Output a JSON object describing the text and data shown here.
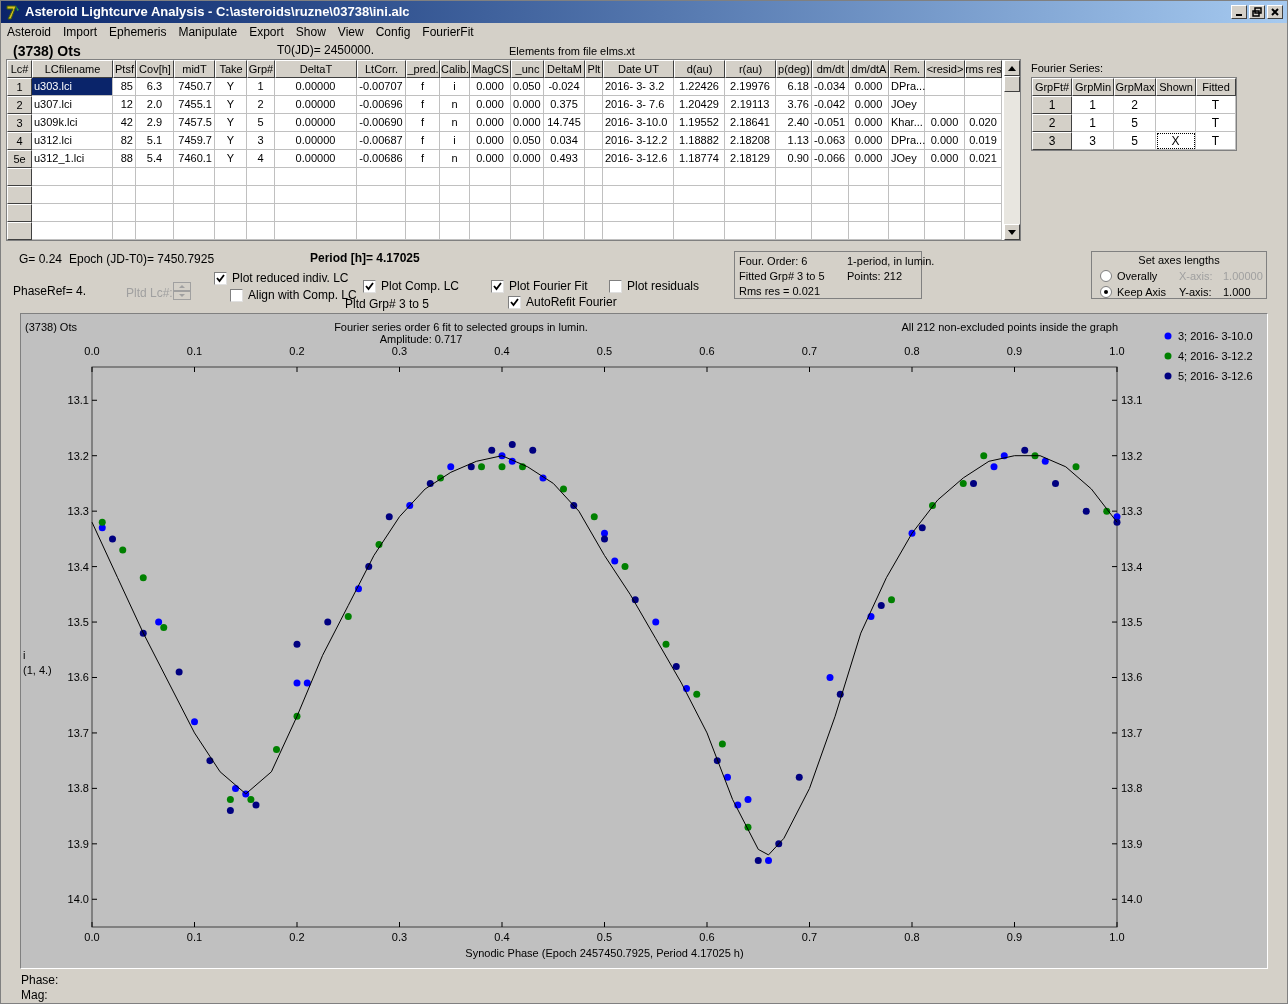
{
  "window": {
    "title": "Asteroid Lightcurve Analysis - C:\\asteroids\\ruzne\\03738\\ini.alc"
  },
  "menu": [
    "Asteroid",
    "Import",
    "Ephemeris",
    "Manipulate",
    "Export",
    "Show",
    "View",
    "Config",
    "FourierFit"
  ],
  "header": {
    "object": "(3738) Ots",
    "t0": "T0(JD)= 2450000.",
    "elements": "Elements from file elms.xt"
  },
  "lc_table": {
    "columns": [
      "Lc#",
      "LCfilename",
      "Ptsf",
      "Cov[h]",
      "midT",
      "Take",
      "Grp#",
      "DeltaT",
      "LtCorr.",
      "_pred.",
      "Calib.",
      "MagCS",
      "_unc",
      "DeltaM",
      "Plt",
      "Date UT",
      "d(au)",
      "r(au)",
      "p(deg)",
      "dm/dt",
      "dm/dtA",
      "Rem.",
      "<resid>",
      "rms res"
    ],
    "rows": [
      {
        "selected": true,
        "cells": [
          "1",
          "u303.lci",
          "85",
          "6.3",
          "7450.7",
          "Y",
          "1",
          "0.00000",
          "-0.00707",
          "f",
          "i",
          "0.000",
          "0.050",
          "-0.024",
          "",
          "2016- 3- 3.2",
          "1.22426",
          "2.19976",
          "6.18",
          "-0.034",
          "0.000",
          "DPra...",
          "",
          ""
        ]
      },
      {
        "selected": false,
        "cells": [
          "2",
          "u307.lci",
          "12",
          "2.0",
          "7455.1",
          "Y",
          "2",
          "0.00000",
          "-0.00696",
          "f",
          "n",
          "0.000",
          "0.000",
          "0.375",
          "",
          "2016- 3- 7.6",
          "1.20429",
          "2.19113",
          "3.76",
          "-0.042",
          "0.000",
          "JOey",
          "",
          ""
        ]
      },
      {
        "selected": false,
        "cells": [
          "3",
          "u309k.lci",
          "42",
          "2.9",
          "7457.5",
          "Y",
          "5",
          "0.00000",
          "-0.00690",
          "f",
          "n",
          "0.000",
          "0.000",
          "14.745",
          "",
          "2016- 3-10.0",
          "1.19552",
          "2.18641",
          "2.40",
          "-0.051",
          "0.000",
          "Khar...",
          "0.000",
          "0.020"
        ]
      },
      {
        "selected": false,
        "cells": [
          "4",
          "u312.lci",
          "82",
          "5.1",
          "7459.7",
          "Y",
          "3",
          "0.00000",
          "-0.00687",
          "f",
          "i",
          "0.000",
          "0.050",
          "0.034",
          "",
          "2016- 3-12.2",
          "1.18882",
          "2.18208",
          "1.13",
          "-0.063",
          "0.000",
          "DPra...",
          "0.000",
          "0.019"
        ]
      },
      {
        "selected": false,
        "cells": [
          "5e",
          "u312_1.lci",
          "88",
          "5.4",
          "7460.1",
          "Y",
          "4",
          "0.00000",
          "-0.00686",
          "f",
          "n",
          "0.000",
          "0.000",
          "0.493",
          "",
          "2016- 3-12.6",
          "1.18774",
          "2.18129",
          "0.90",
          "-0.066",
          "0.000",
          "JOey",
          "0.000",
          "0.021"
        ]
      }
    ]
  },
  "fourier_series": {
    "title": "Fourier Series:",
    "columns": [
      "GrpFt#",
      "GrpMin",
      "GrpMax",
      "Shown",
      "Fitted"
    ],
    "rows": [
      {
        "focused": false,
        "cells": [
          "1",
          "1",
          "2",
          "",
          "T"
        ]
      },
      {
        "focused": false,
        "cells": [
          "2",
          "1",
          "5",
          "",
          "T"
        ]
      },
      {
        "focused": true,
        "cells": [
          "3",
          "3",
          "5",
          "X",
          "T"
        ]
      }
    ]
  },
  "info": {
    "g": "G= 0.24",
    "epoch": "Epoch (JD-T0)= 7450.7925",
    "period": "Period [h]= 4.17025",
    "phase_ref": "PhaseRef= 4.",
    "pltd_lc": {
      "label": "Pltd Lc#:",
      "disabled": true
    },
    "pltd_grp": "Pltd Grp#  3   to   5"
  },
  "plot_options": [
    {
      "label": "Plot reduced indiv. LC",
      "checked": true
    },
    {
      "label": "Align with Comp. LC",
      "checked": false
    },
    {
      "label": "Plot Comp. LC",
      "checked": true
    },
    {
      "label": "Plot Fourier Fit",
      "checked": true
    },
    {
      "label": "AutoRefit Fourier",
      "checked": true
    },
    {
      "label": "Plot residuals",
      "checked": false
    }
  ],
  "fit_summary": [
    "Four. Order:  6",
    "1-period, in lumin.",
    "Fitted Grp# 3 to 5",
    "Points: 212",
    "Rms res     = 0.021"
  ],
  "axes_lengths": {
    "title": "Set axes lengths",
    "options": [
      {
        "label": "Overally",
        "selected": false
      },
      {
        "label": "Keep Axis",
        "selected": true
      }
    ],
    "fields": [
      {
        "label": "X-axis:",
        "value": "1.00000",
        "disabled": true
      },
      {
        "label": "Y-axis:",
        "value": "1.000",
        "disabled": false
      }
    ]
  },
  "plot": {
    "object": "(3738) Ots",
    "subtitle": "Fourier series order 6 fit to selected groups in lumin.",
    "amplitude": "Amplitude: 0.717",
    "points_note": "All 212 non-excluded points inside the graph",
    "y_scale": "(1, 4.)",
    "chart_data": {
      "type": "scatter",
      "xlabel": "Synodic Phase (Epoch 2457450.7925, Period 4.17025 h)",
      "ylabel": "i",
      "xlim": [
        0,
        1
      ],
      "legend": "right",
      "ylim": [
        14.05,
        13.04
      ],
      "xticks": [
        {
          "value": 0,
          "label": "0.0"
        },
        {
          "value": 0.1,
          "label": "0.1"
        },
        {
          "value": 0.2,
          "label": "0.2"
        },
        {
          "value": 0.3,
          "label": "0.3"
        },
        {
          "value": 0.4,
          "label": "0.4"
        },
        {
          "value": 0.5,
          "label": "0.5"
        },
        {
          "value": 0.6,
          "label": "0.6"
        },
        {
          "value": 0.7,
          "label": "0.7"
        },
        {
          "value": 0.8,
          "label": "0.8"
        },
        {
          "value": 0.9,
          "label": "0.9"
        },
        {
          "value": 1,
          "label": "1.0"
        }
      ],
      "yticks": [
        {
          "value": 13.1,
          "label": "13.1"
        },
        {
          "value": 13.2,
          "label": "13.2"
        },
        {
          "value": 13.3,
          "label": "13.3"
        },
        {
          "value": 13.4,
          "label": "13.4"
        },
        {
          "value": 13.5,
          "label": "13.5"
        },
        {
          "value": 13.6,
          "label": "13.6"
        },
        {
          "value": 13.7,
          "label": "13.7"
        },
        {
          "value": 13.8,
          "label": "13.8"
        },
        {
          "value": 13.9,
          "label": "13.9"
        },
        {
          "value": 14.0,
          "label": "14.0"
        }
      ],
      "series": [
        {
          "name": "3; 2016- 3-10.0",
          "color": "#0000ff",
          "x": [
            0.01,
            0.065,
            0.1,
            0.14,
            0.15,
            0.2,
            0.21,
            0.26,
            0.31,
            0.35,
            0.4,
            0.41,
            0.44,
            0.5,
            0.51,
            0.55,
            0.58,
            0.62,
            0.63,
            0.64,
            0.66,
            0.72,
            0.76,
            0.8,
            0.88,
            0.89,
            0.93,
            1.0
          ],
          "values": [
            13.33,
            13.5,
            13.68,
            13.8,
            13.81,
            13.61,
            13.61,
            13.44,
            13.29,
            13.22,
            13.2,
            13.21,
            13.24,
            13.34,
            13.39,
            13.5,
            13.62,
            13.78,
            13.83,
            13.82,
            13.93,
            13.6,
            13.49,
            13.34,
            13.22,
            13.2,
            13.21,
            13.31
          ]
        },
        {
          "name": "4; 2016- 3-12.2",
          "color": "#008000",
          "x": [
            0.01,
            0.03,
            0.05,
            0.07,
            0.135,
            0.155,
            0.18,
            0.2,
            0.25,
            0.28,
            0.34,
            0.38,
            0.4,
            0.42,
            0.46,
            0.49,
            0.52,
            0.56,
            0.59,
            0.615,
            0.64,
            0.78,
            0.82,
            0.85,
            0.87,
            0.92,
            0.96,
            0.99
          ],
          "values": [
            13.32,
            13.37,
            13.42,
            13.51,
            13.82,
            13.82,
            13.73,
            13.67,
            13.49,
            13.36,
            13.24,
            13.22,
            13.22,
            13.22,
            13.26,
            13.31,
            13.4,
            13.54,
            13.63,
            13.72,
            13.87,
            13.46,
            13.29,
            13.25,
            13.2,
            13.2,
            13.22,
            13.3
          ]
        },
        {
          "name": "5; 2016- 3-12.6",
          "color": "#000080",
          "x": [
            0.02,
            0.05,
            0.085,
            0.115,
            0.135,
            0.16,
            0.2,
            0.23,
            0.27,
            0.29,
            0.33,
            0.37,
            0.39,
            0.41,
            0.43,
            0.47,
            0.5,
            0.53,
            0.57,
            0.61,
            0.65,
            0.67,
            0.69,
            0.73,
            0.77,
            0.81,
            0.86,
            0.91,
            0.94,
            0.97,
            1.0
          ],
          "values": [
            13.35,
            13.52,
            13.59,
            13.75,
            13.84,
            13.83,
            13.54,
            13.5,
            13.4,
            13.31,
            13.25,
            13.22,
            13.19,
            13.18,
            13.19,
            13.29,
            13.35,
            13.46,
            13.58,
            13.75,
            13.93,
            13.9,
            13.78,
            13.63,
            13.47,
            13.33,
            13.25,
            13.19,
            13.25,
            13.3,
            13.32
          ]
        },
        {
          "type": "line",
          "color": "#000000",
          "x": [
            0,
            0.025,
            0.05,
            0.075,
            0.1,
            0.125,
            0.15,
            0.175,
            0.2,
            0.225,
            0.25,
            0.275,
            0.3,
            0.325,
            0.35,
            0.375,
            0.4,
            0.425,
            0.45,
            0.475,
            0.5,
            0.525,
            0.55,
            0.575,
            0.6,
            0.625,
            0.65,
            0.66,
            0.675,
            0.7,
            0.725,
            0.75,
            0.775,
            0.8,
            0.825,
            0.85,
            0.875,
            0.9,
            0.925,
            0.95,
            0.975,
            1.0
          ],
          "values": [
            13.32,
            13.42,
            13.52,
            13.61,
            13.7,
            13.77,
            13.81,
            13.77,
            13.67,
            13.56,
            13.47,
            13.38,
            13.31,
            13.26,
            13.23,
            13.21,
            13.2,
            13.22,
            13.25,
            13.3,
            13.38,
            13.45,
            13.53,
            13.61,
            13.7,
            13.82,
            13.91,
            13.92,
            13.89,
            13.8,
            13.67,
            13.52,
            13.42,
            13.34,
            13.28,
            13.24,
            13.21,
            13.2,
            13.2,
            13.22,
            13.26,
            13.32
          ]
        }
      ]
    }
  },
  "status": {
    "phase": "Phase:",
    "mag": "Mag:"
  }
}
